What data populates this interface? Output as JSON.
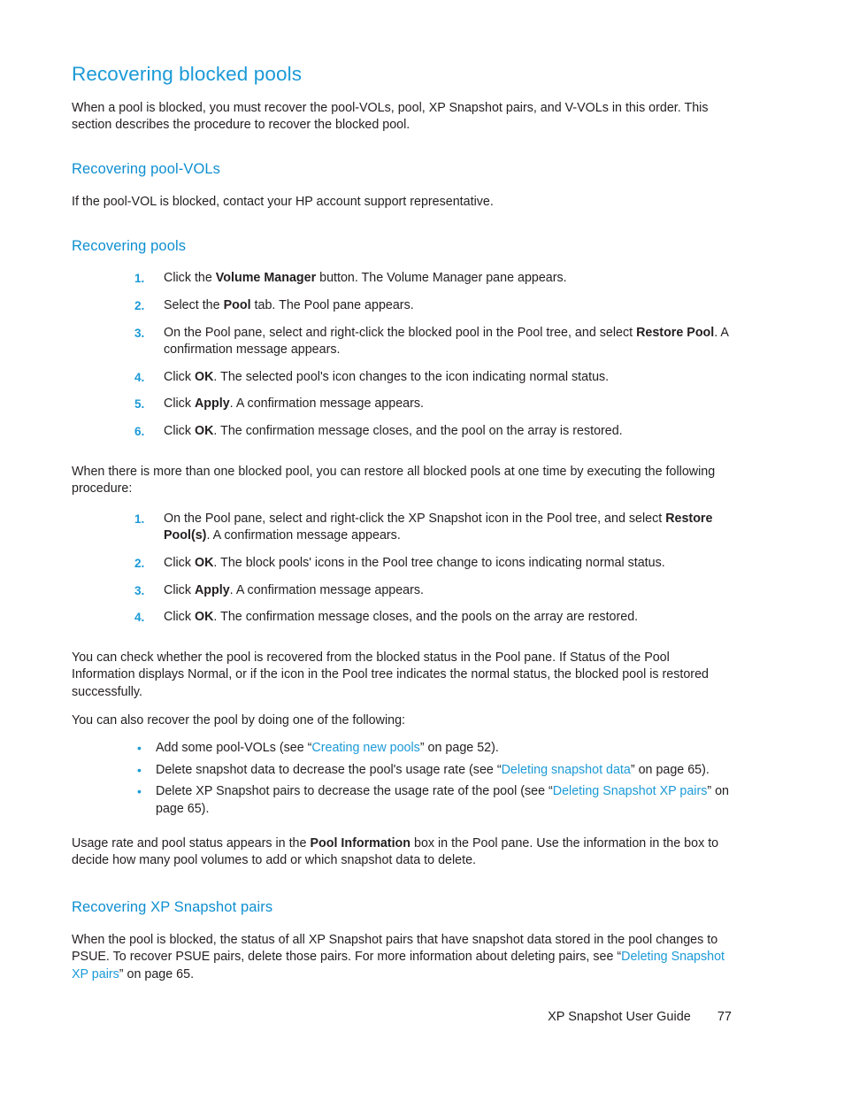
{
  "document": {
    "title": "Recovering blocked pools",
    "footer": {
      "guide_name": "XP Snapshot User Guide",
      "page_number": "77"
    },
    "colors": {
      "heading_blue": "#1b9ad7",
      "subheading_blue": "#0f8fd0",
      "link_blue": "#1b9ad7",
      "body_text": "#231f20",
      "page_background": "#ffffff"
    }
  },
  "intro": {
    "line1": "When a pool is blocked, you must recover the pool-VOLs, pool, XP Snapshot pairs, and V-VOLs in",
    "line2": "this order. This section describes the procedure to recover the blocked pool.",
    "full": "When a pool is blocked, you must recover the pool-VOLs, pool, XP Snapshot pairs, and V-VOLs in this order. This section describes the procedure to recover the blocked pool."
  },
  "section_pool_vols": {
    "heading": "Recovering pool-VOLs",
    "body": "If the pool-VOL is blocked, contact your HP account support representative."
  },
  "section_pools": {
    "heading": "Recovering pools",
    "steps_primary": [
      {
        "num": "1.",
        "pre": "Click the ",
        "bold": "Volume Manager",
        "post": " button. The Volume Manager pane appears."
      },
      {
        "num": "2.",
        "pre": "Select the ",
        "bold": "Pool",
        "post": " tab. The Pool pane appears."
      },
      {
        "num": "3.",
        "pre": "On the Pool pane, select and right-click the blocked pool in the Pool tree, and select ",
        "bold": "Restore Pool",
        "post": ". A confirmation message appears."
      },
      {
        "num": "4.",
        "pre": "Click ",
        "bold": "OK",
        "post": ". The selected pool's icon changes to the icon indicating normal status."
      },
      {
        "num": "5.",
        "pre": "Click ",
        "bold": "Apply",
        "post": ". A confirmation message appears."
      },
      {
        "num": "6.",
        "pre": "Click ",
        "bold": "OK",
        "post": ". The confirmation message closes, and the pool on the array is restored."
      }
    ],
    "multi_intro": "When there is more than one blocked pool, you can restore all blocked pools at one time by executing the following procedure:",
    "steps_multi": [
      {
        "num": "1.",
        "pre": "On the Pool pane, select and right-click the XP Snapshot icon in the Pool tree, and select ",
        "bold": "Restore Pool(s)",
        "post": ". A confirmation message appears."
      },
      {
        "num": "2.",
        "pre": "Click ",
        "bold": "OK",
        "post": ". The block pools' icons in the Pool tree change to icons indicating normal status."
      },
      {
        "num": "3.",
        "pre": "Click ",
        "bold": "Apply",
        "post": ". A confirmation message appears."
      },
      {
        "num": "4.",
        "pre": "Click ",
        "bold": "OK",
        "post": ". The confirmation message closes, and the pools on the array are restored."
      }
    ],
    "check_paragraph": "You can check whether the pool is recovered from the blocked status in the Pool pane. If Status of the Pool Information displays Normal, or if the icon in the Pool tree indicates the normal status, the blocked pool is restored successfully.",
    "alternatives_lead": "You can also recover the pool by doing one of the following:",
    "alternatives": [
      {
        "pre": "Add some pool-VOLs (see “",
        "link": "Creating new pools",
        "post": "” on page 52)."
      },
      {
        "pre": "Delete snapshot data to decrease the pool's usage rate (see “",
        "link": "Deleting snapshot data",
        "post": "” on page 65)."
      },
      {
        "pre": "Delete XP Snapshot pairs to decrease the usage rate of the pool (see “",
        "link": "Deleting Snapshot XP pairs",
        "post": "” on page 65)."
      }
    ],
    "usage_rate": {
      "pre": "Usage rate and pool status appears in the ",
      "bold": "Pool Information",
      "post": " box in the Pool pane. Use the information in the box to decide how many pool volumes to add or which snapshot data to delete."
    }
  },
  "section_pairs": {
    "heading": "Recovering XP Snapshot pairs",
    "body": {
      "pre": "When the pool is blocked, the status of all XP Snapshot pairs that have snapshot data stored in the pool changes to PSUE. To recover PSUE pairs, delete those pairs. For more information about deleting pairs, see “",
      "link": "Deleting Snapshot XP pairs",
      "post": "” on page 65."
    }
  }
}
